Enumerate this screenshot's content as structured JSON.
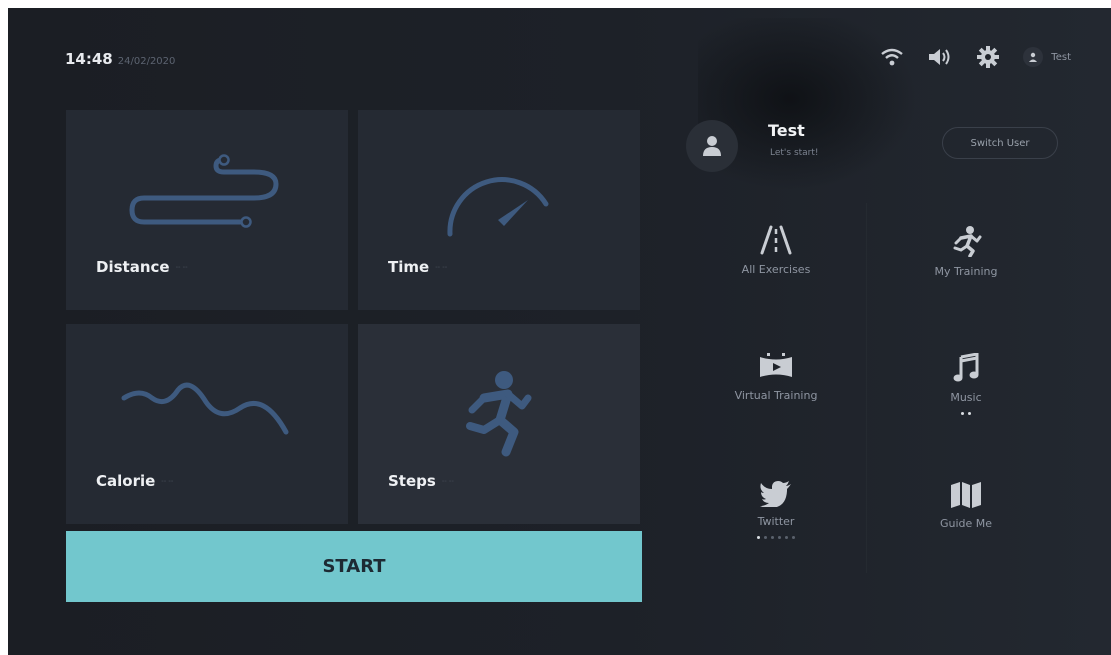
{
  "status": {
    "time": "14:48",
    "date": "24/02/2020"
  },
  "topbar": {
    "icons": [
      "wifi-icon",
      "volume-icon",
      "gear-icon",
      "user-icon"
    ],
    "user_name": "Test"
  },
  "tiles": [
    {
      "label": "Distance",
      "unit": "-- --",
      "icon": "route-icon"
    },
    {
      "label": "Time",
      "unit": "-- --",
      "icon": "speedometer-icon"
    },
    {
      "label": "Calorie",
      "unit": "-- --",
      "icon": "wave-icon"
    },
    {
      "label": "Steps",
      "unit": "-- --",
      "icon": "runner-icon"
    }
  ],
  "start_label": "START",
  "profile": {
    "name": "Test",
    "subtitle": "Let's start!",
    "switch_label": "Switch User"
  },
  "menu": [
    {
      "label": "All Exercises",
      "icon": "road-icon"
    },
    {
      "label": "My Training",
      "icon": "running-man-icon"
    },
    {
      "label": "Virtual Training",
      "icon": "video-icon"
    },
    {
      "label": "Music",
      "icon": "music-note-icon"
    },
    {
      "label": "Twitter",
      "icon": "twitter-icon"
    },
    {
      "label": "Guide Me",
      "icon": "map-icon"
    }
  ],
  "colors": {
    "accent": "#72c7cd",
    "icon_blue": "#3e5a7f",
    "tile_bg": "#252a33"
  }
}
